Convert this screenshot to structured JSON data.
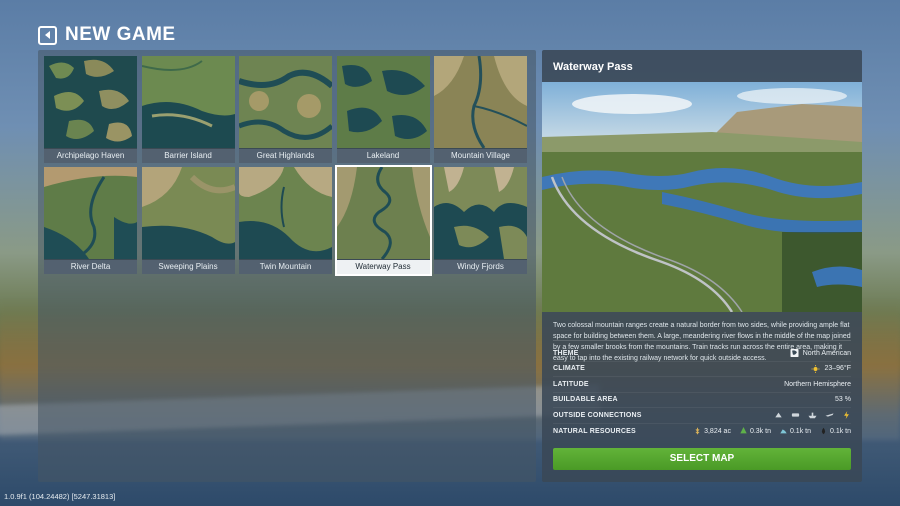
{
  "header": {
    "title": "NEW GAME"
  },
  "maps": [
    {
      "name": "Archipelago Haven",
      "selected": false
    },
    {
      "name": "Barrier Island",
      "selected": false
    },
    {
      "name": "Great Highlands",
      "selected": false
    },
    {
      "name": "Lakeland",
      "selected": false
    },
    {
      "name": "Mountain Village",
      "selected": false
    },
    {
      "name": "River Delta",
      "selected": false
    },
    {
      "name": "Sweeping Plains",
      "selected": false
    },
    {
      "name": "Twin Mountain",
      "selected": false
    },
    {
      "name": "Waterway Pass",
      "selected": true
    },
    {
      "name": "Windy Fjords",
      "selected": false
    }
  ],
  "details": {
    "title": "Waterway Pass",
    "description": "Two colossal mountain ranges create a natural border from two sides, while providing ample flat space for building between them. A large, meandering river flows in the middle of the map joined by a few smaller brooks from the mountains. Train tracks run across the entire area, making it easy to tap into the existing railway network for quick outside access.",
    "theme_label": "THEME",
    "theme_value": "North American",
    "climate_label": "CLIMATE",
    "climate_value": "23–96°F",
    "latitude_label": "LATITUDE",
    "latitude_value": "Northern Hemisphere",
    "buildable_label": "BUILDABLE AREA",
    "buildable_value": "53 %",
    "connections_label": "OUTSIDE CONNECTIONS",
    "connections_icons": [
      "road-icon",
      "train-icon",
      "ship-icon",
      "plane-icon",
      "power-icon"
    ],
    "resources_label": "NATURAL RESOURCES",
    "resources": [
      {
        "icon": "fertile-land-icon",
        "value": "3,824 ac"
      },
      {
        "icon": "forest-icon",
        "value": "0.3k tn"
      },
      {
        "icon": "ore-icon",
        "value": "0.1k tn"
      },
      {
        "icon": "oil-icon",
        "value": "0.1k tn"
      }
    ],
    "select_label": "SELECT MAP"
  },
  "colors": {
    "accent_green": "#52a52d",
    "climate_sun": "#f2c230",
    "power_yellow": "#f2c230"
  },
  "version": "1.0.9f1 (104.24482) [5247.31813]"
}
